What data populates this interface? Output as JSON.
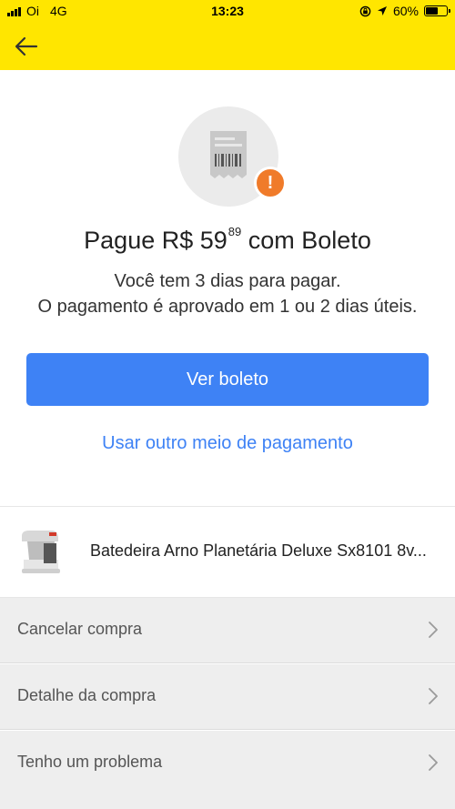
{
  "status_bar": {
    "carrier": "Oi",
    "network": "4G",
    "time": "13:23",
    "battery": "60%",
    "battery_level": 0.6
  },
  "header": {
    "back_icon": "arrow-left-icon"
  },
  "hero": {
    "icon": "receipt-icon",
    "badge_icon": "exclamation-icon",
    "badge_color": "#F07B2A"
  },
  "payment": {
    "title_prefix": "Pague R$ 59",
    "title_cents": "89",
    "title_suffix": "com Boleto",
    "line1": "Você tem 3 dias para pagar.",
    "line2": "O pagamento é aprovado em 1 ou 2 dias úteis.",
    "primary_button": "Ver boleto",
    "secondary_link": "Usar outro meio de pagamento"
  },
  "product": {
    "name": "Batedeira Arno Planetária Deluxe Sx8101 8v..."
  },
  "menu": [
    {
      "label": "Cancelar compra"
    },
    {
      "label": "Detalhe da compra"
    },
    {
      "label": "Tenho um problema"
    }
  ],
  "colors": {
    "brand_yellow": "#FFE600",
    "primary_blue": "#3E82F5",
    "alert_orange": "#F07B2A"
  }
}
